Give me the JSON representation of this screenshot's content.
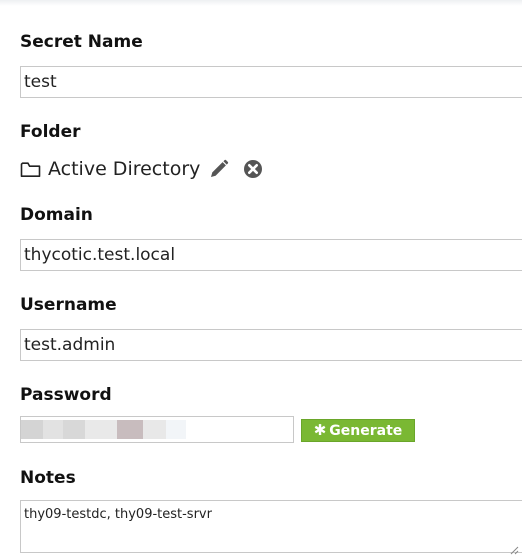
{
  "form": {
    "secret_name": {
      "label": "Secret Name",
      "value": "test"
    },
    "folder": {
      "label": "Folder",
      "value": "Active Directory",
      "icons": [
        "folder-icon",
        "pencil-icon",
        "remove-circle-icon"
      ]
    },
    "domain": {
      "label": "Domain",
      "value": "thycotic.test.local"
    },
    "username": {
      "label": "Username",
      "value": "test.admin"
    },
    "password": {
      "label": "Password",
      "masked": true,
      "generate_label": "Generate",
      "generate_icon": "asterisk-icon"
    },
    "notes": {
      "label": "Notes",
      "value": "thy09-testdc, thy09-test-srvr"
    }
  },
  "colors": {
    "generate_button": "#7ab833",
    "label_text": "#111111",
    "field_border": "#c8c8c8"
  }
}
